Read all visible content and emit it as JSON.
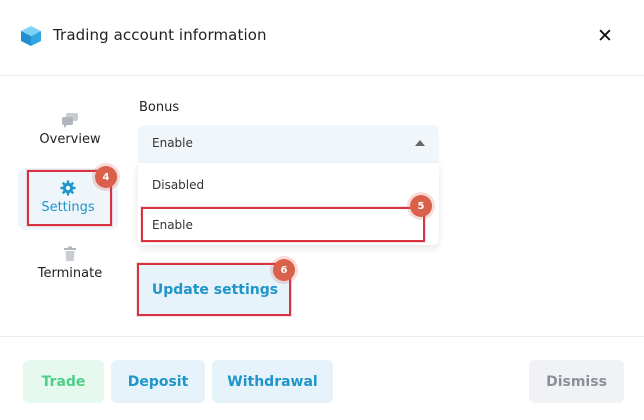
{
  "header": {
    "title": "Trading account information",
    "logo_icon": "cube-logo-icon",
    "close_icon": "close-icon",
    "close_glyph": "✕"
  },
  "sidebar": {
    "items": [
      {
        "label": "Overview",
        "icon": "chat-bubbles-icon"
      },
      {
        "label": "Settings",
        "icon": "gear-icon",
        "active": true
      },
      {
        "label": "Terminate",
        "icon": "trash-icon"
      }
    ]
  },
  "settings": {
    "bonus_label": "Bonus",
    "select_value": "Enable",
    "options": [
      "Disabled",
      "Enable"
    ],
    "update_label": "Update settings"
  },
  "footer": {
    "trade_label": "Trade",
    "deposit_label": "Deposit",
    "withdrawal_label": "Withdrawal",
    "dismiss_label": "Dismiss"
  },
  "annotations": {
    "step_4": "4",
    "step_5": "5",
    "step_6": "6"
  },
  "colors": {
    "accent": "#1f95c9",
    "trade": "#4fcf86",
    "highlight": "#d63240",
    "step_badge": "#d9614c"
  }
}
